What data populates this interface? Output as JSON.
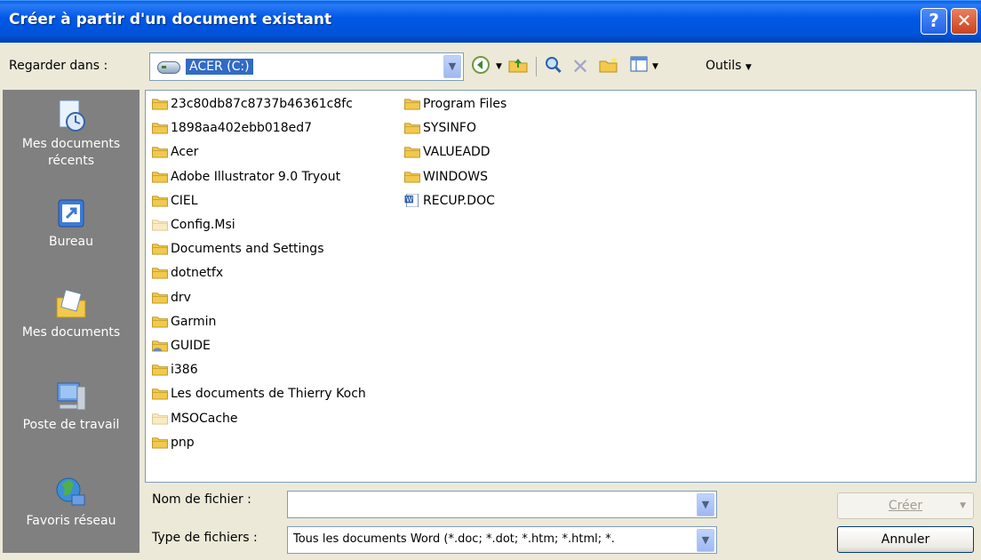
{
  "window": {
    "title": "Créer à partir d'un document existant",
    "help_label": "?",
    "close_label": "✕"
  },
  "toolbar": {
    "lookin_label": "Regarder dans :",
    "lookin_value": "ACER (C:)",
    "tools_label": "Outils",
    "icons": [
      "back-icon",
      "up-folder-icon",
      "search-web-icon",
      "delete-icon",
      "new-folder-icon",
      "views-icon"
    ]
  },
  "places": [
    {
      "label": "Mes documents récents",
      "icon": "recent-documents-icon"
    },
    {
      "label": "Bureau",
      "icon": "desktop-icon"
    },
    {
      "label": "Mes documents",
      "icon": "my-documents-icon"
    },
    {
      "label": "Poste de travail",
      "icon": "my-computer-icon"
    },
    {
      "label": "Favoris réseau",
      "icon": "network-places-icon"
    }
  ],
  "files": {
    "column1": [
      {
        "name": "23c80db87c8737b46361c8fc",
        "type": "folder"
      },
      {
        "name": "1898aa402ebb018ed7",
        "type": "folder"
      },
      {
        "name": "Acer",
        "type": "folder"
      },
      {
        "name": "Adobe Illustrator 9.0 Tryout",
        "type": "folder"
      },
      {
        "name": "CIEL",
        "type": "folder"
      },
      {
        "name": "Config.Msi",
        "type": "folder-hidden"
      },
      {
        "name": "Documents and Settings",
        "type": "folder"
      },
      {
        "name": "dotnetfx",
        "type": "folder"
      },
      {
        "name": "drv",
        "type": "folder"
      },
      {
        "name": "Garmin",
        "type": "folder"
      },
      {
        "name": "GUIDE",
        "type": "folder-shared"
      },
      {
        "name": "i386",
        "type": "folder"
      },
      {
        "name": "Les documents de Thierry Koch",
        "type": "folder"
      },
      {
        "name": "MSOCache",
        "type": "folder-hidden"
      },
      {
        "name": "pnp",
        "type": "folder"
      }
    ],
    "column2": [
      {
        "name": "Program Files",
        "type": "folder"
      },
      {
        "name": "SYSINFO",
        "type": "folder"
      },
      {
        "name": "VALUEADD",
        "type": "folder"
      },
      {
        "name": "WINDOWS",
        "type": "folder"
      },
      {
        "name": "RECUP.DOC",
        "type": "word-doc"
      }
    ]
  },
  "form": {
    "filename_label": "Nom de fichier :",
    "filename_value": "",
    "filetype_label": "Type de fichiers :",
    "filetype_value": "Tous les documents Word (*.doc; *.dot; *.htm; *.html; *.",
    "create_label": "Créer",
    "cancel_label": "Annuler"
  }
}
